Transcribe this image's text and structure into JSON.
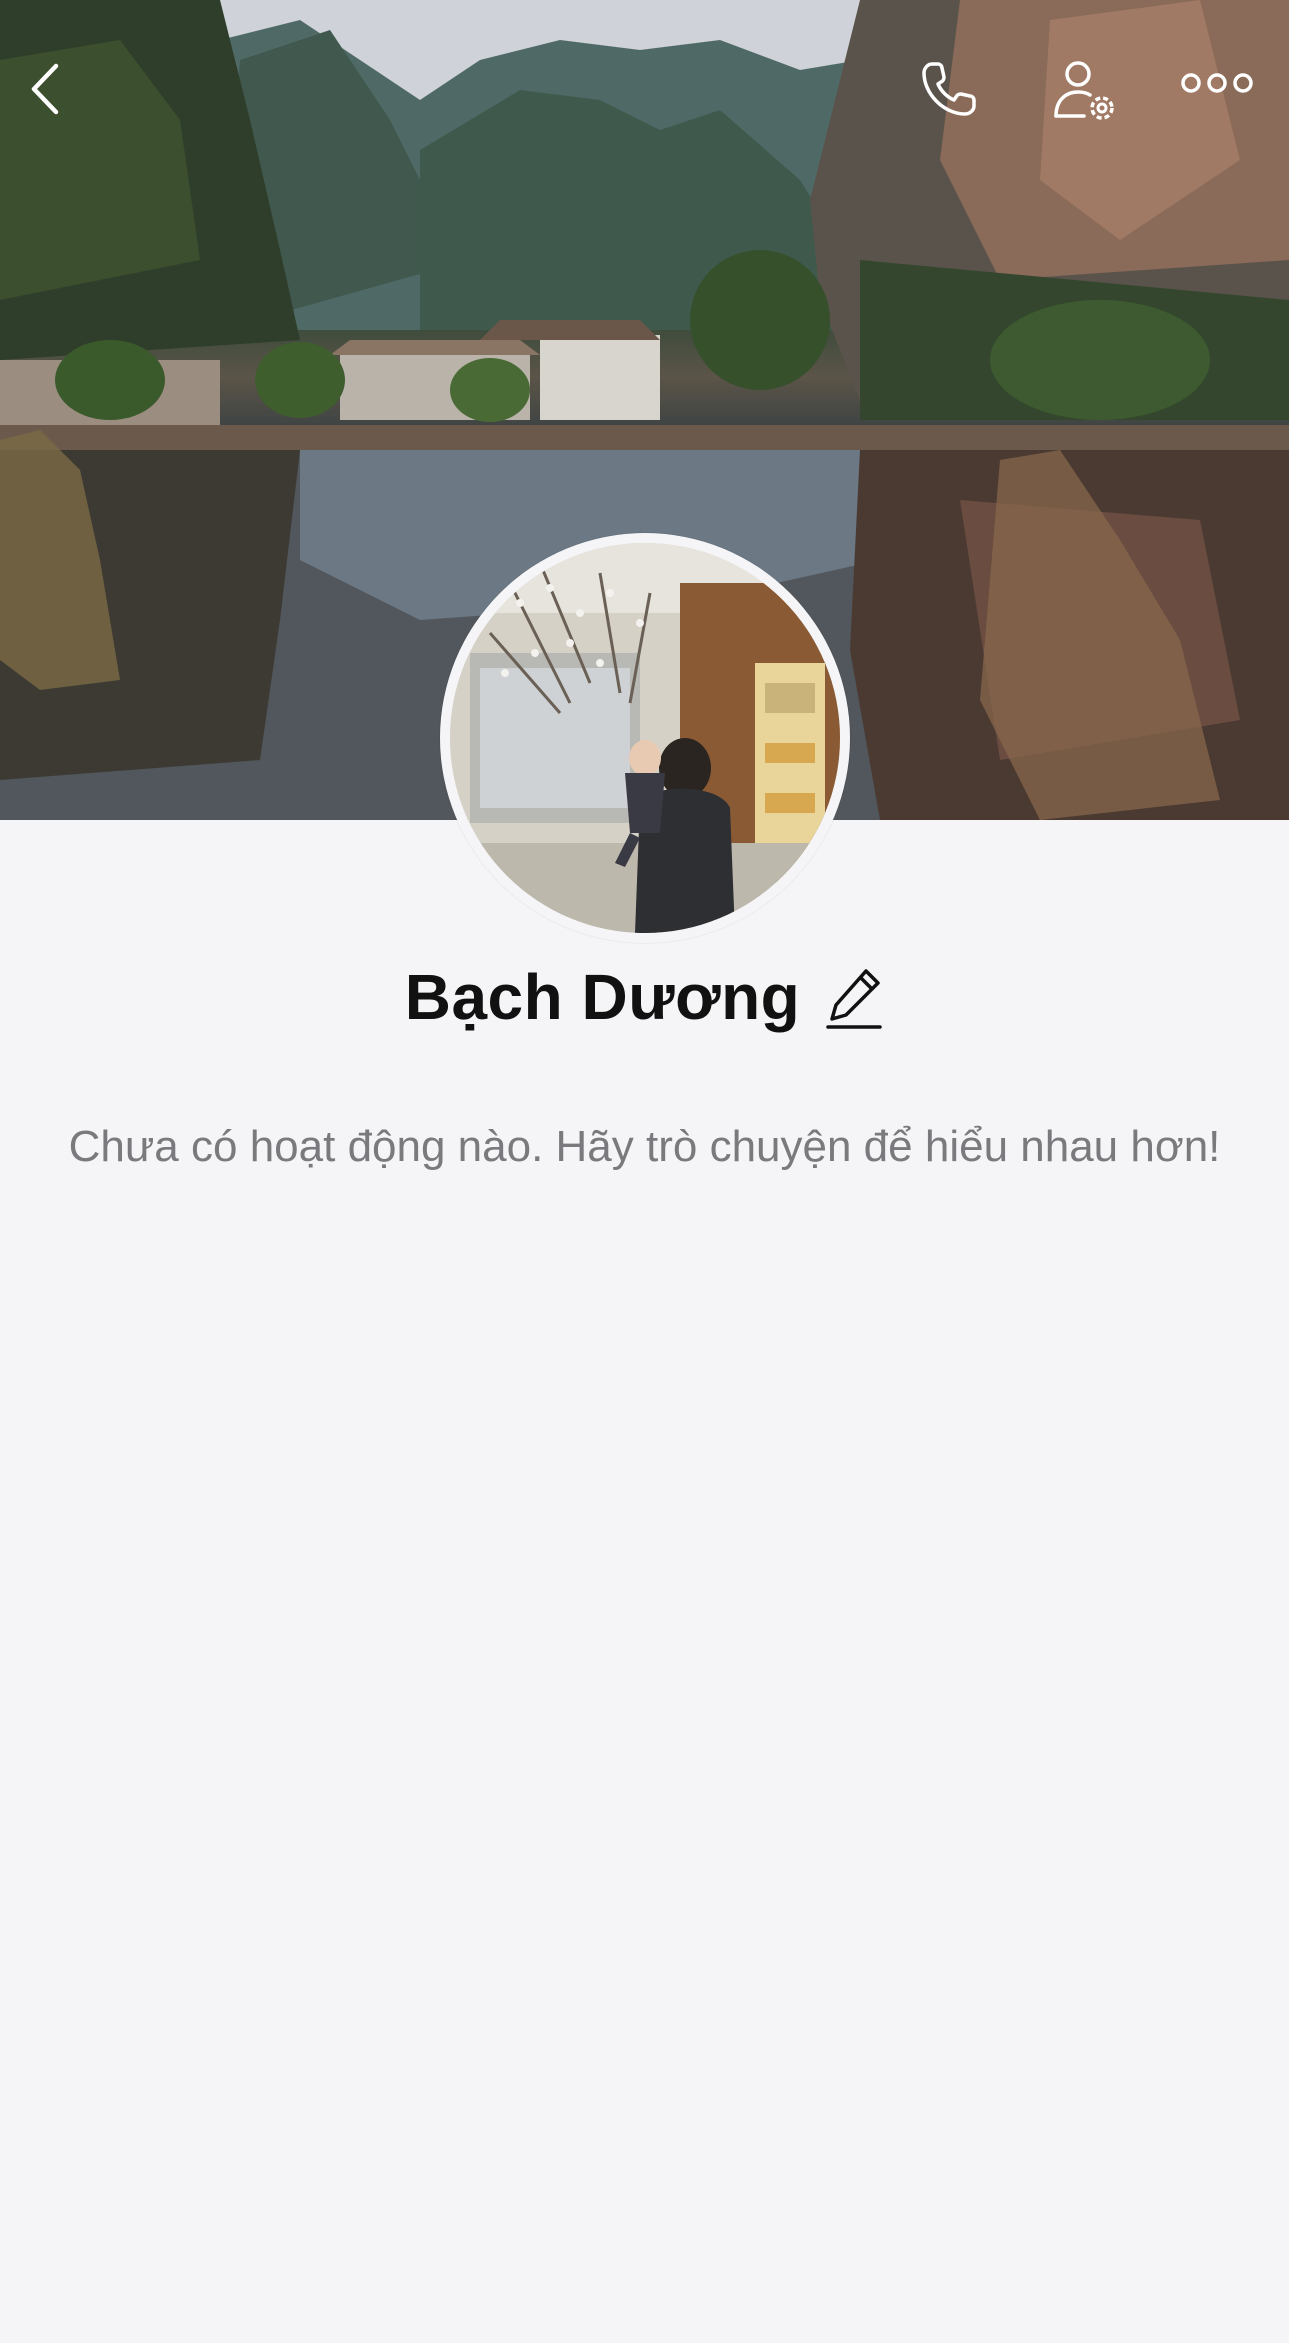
{
  "profile": {
    "name": "Bạch Dương",
    "empty_activity_text": "Chưa có hoạt động nào. Hãy trò chuyện để hiểu nhau hơn!"
  },
  "header": {
    "back_icon": "chevron-left-icon",
    "call_icon": "phone-icon",
    "friend_settings_icon": "user-gear-icon",
    "more_icon": "more-dots-icon"
  },
  "colors": {
    "background": "#f5f5f7",
    "name_text": "#111111",
    "secondary_text": "#7a7a7e",
    "icon_on_cover": "#ffffff"
  }
}
